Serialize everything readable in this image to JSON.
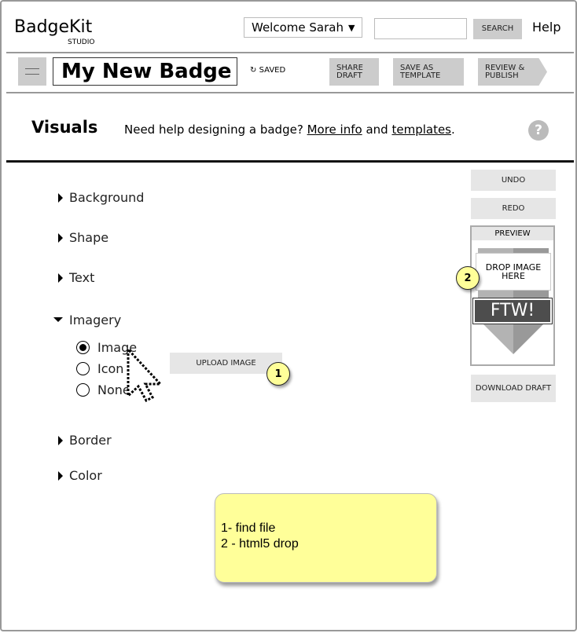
{
  "header": {
    "brand": "BadgeKit",
    "brand_sub": "STUDIO",
    "welcome": "Welcome Sarah",
    "search_value": "",
    "search_label": "SEARCH",
    "help": "Help"
  },
  "toolbar": {
    "badge_name": "My New Badge",
    "saved": "SAVED",
    "share": "SHARE DRAFT",
    "save_template": "SAVE AS TEMPLATE",
    "review": "REVIEW & PUBLISH"
  },
  "visuals": {
    "title": "Visuals",
    "help_text": "Need help designing a badge?",
    "more_info": "More info",
    "and": "and",
    "templates": "templates",
    "period": ".",
    "help_icon": "?"
  },
  "sections": {
    "background": "Background",
    "shape": "Shape",
    "text": "Text",
    "imagery": "Imagery",
    "border": "Border",
    "color": "Color"
  },
  "imagery": {
    "options": [
      "Image",
      "Icon",
      "None"
    ],
    "selected": "Image",
    "upload": "UPLOAD IMAGE"
  },
  "right": {
    "undo": "UNDO",
    "redo": "REDO",
    "preview": "PREVIEW",
    "drop": "DROP IMAGE HERE",
    "ftw": "FTW!",
    "download": "DOWNLOAD DRAFT"
  },
  "annotations": {
    "one": "1",
    "two": "2",
    "note_line1": "1- find file",
    "note_line2": "2 - html5 drop"
  }
}
